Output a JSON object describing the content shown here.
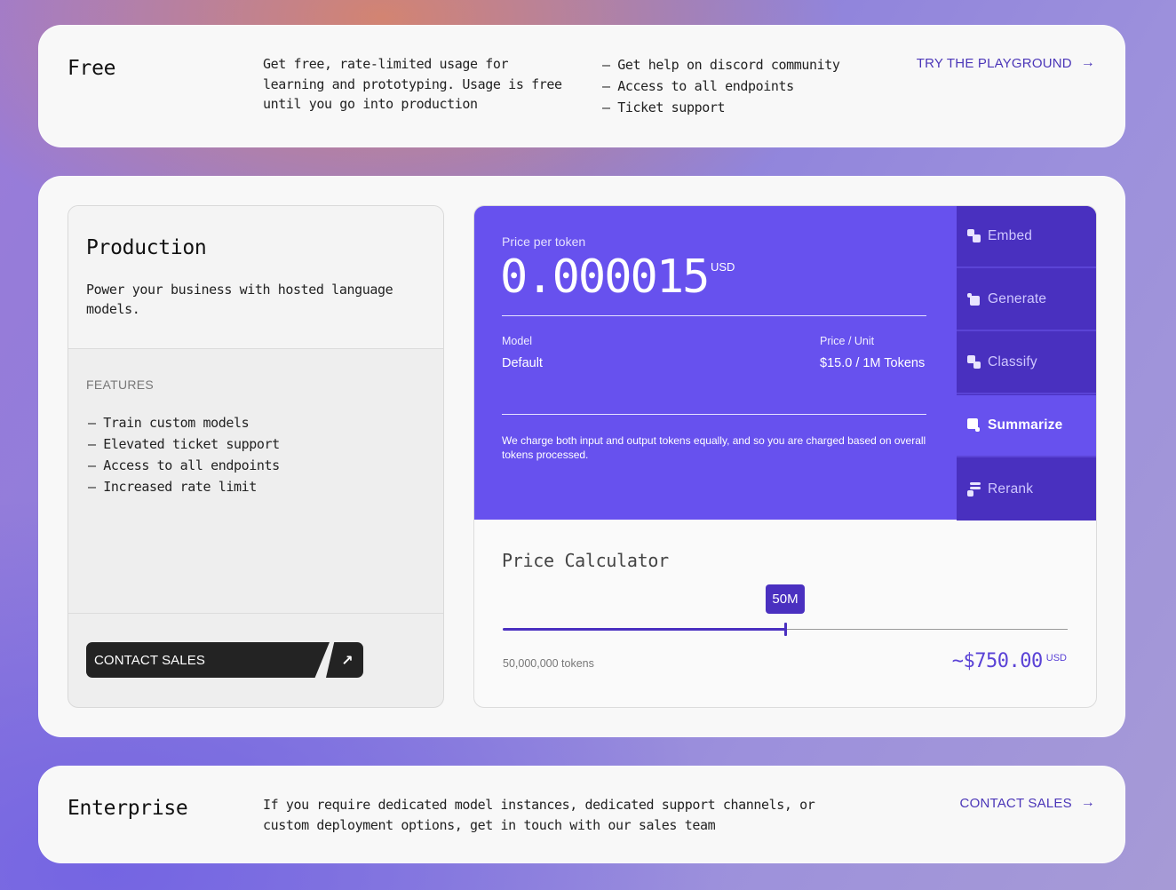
{
  "free": {
    "title": "Free",
    "description": "Get free, rate-limited usage for learning and prototyping. Usage is free until you go into production",
    "features": [
      "— Get help on discord community",
      "— Access to all endpoints",
      "— Ticket support"
    ],
    "link_label": "TRY THE PLAYGROUND",
    "link_icon": "arrow-right-icon"
  },
  "production": {
    "title": "Production",
    "description": "Power your business with hosted language models.",
    "features_label": "FEATURES",
    "features": [
      "— Train custom models",
      "— Elevated ticket support",
      "— Access to all endpoints",
      "— Increased rate limit"
    ],
    "contact_label": "CONTACT SALES",
    "contact_icon": "arrow-up-right-icon",
    "pricing": {
      "price_label": "Price per token",
      "price_value": "0.000015",
      "price_unit": "USD",
      "model_label": "Model",
      "model_value": "Default",
      "unit_price_label": "Price / Unit",
      "unit_price_value": "$15.0 / 1M Tokens",
      "note": "We charge both input and output tokens equally, and so you are charged based on overall tokens processed."
    },
    "tabs": [
      {
        "label": "Embed",
        "icon": "embed-icon",
        "active": false
      },
      {
        "label": "Generate",
        "icon": "generate-icon",
        "active": false
      },
      {
        "label": "Classify",
        "icon": "classify-icon",
        "active": false
      },
      {
        "label": "Summarize",
        "icon": "summarize-icon",
        "active": true
      },
      {
        "label": "Rerank",
        "icon": "rerank-icon",
        "active": false
      }
    ],
    "calculator": {
      "title": "Price Calculator",
      "slider_label": "50M",
      "slider_fraction": 0.5,
      "tokens_text": "50,000,000 tokens",
      "total_value": "~$750.00",
      "total_unit": "USD"
    }
  },
  "enterprise": {
    "title": "Enterprise",
    "description": "If you require dedicated model instances, dedicated support channels, or custom deployment options, get in touch with our sales team",
    "link_label": "CONTACT SALES",
    "link_icon": "arrow-right-icon"
  },
  "colors": {
    "accent": "#6751ee",
    "accent_dark": "#4a30c0",
    "link": "#4b36b8"
  }
}
